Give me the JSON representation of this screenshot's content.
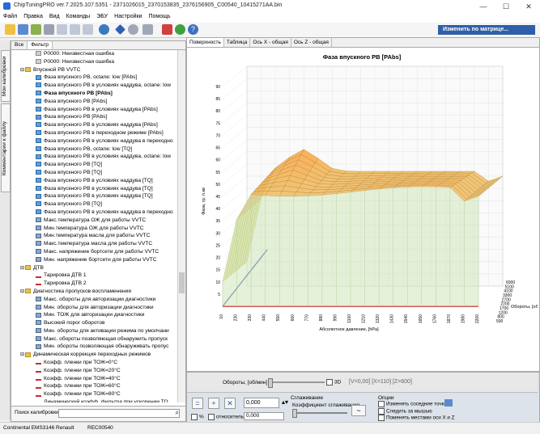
{
  "window": {
    "title": "ChipTuningPRO ver.7.2025.107.5351 - 2371026015_2370153835_2376156905_C00540_10415271AA.bin",
    "minimize": "—",
    "maximize": "☐",
    "close": "✕"
  },
  "menu": [
    "Файл",
    "Правка",
    "Вид",
    "Команды",
    "ЭБУ",
    "Настройки",
    "Помощь"
  ],
  "toolbar": {
    "matrix_dropdown": "Изменить по матрице..."
  },
  "left_tabs": [
    "Мои калибровки",
    "Комментарии к файлу"
  ],
  "panel_tabs": [
    "Все",
    "Фильтр"
  ],
  "tree_rows": [
    {
      "t": "P0000: Неизвестная ошибка",
      "icon": "err",
      "indent": 2
    },
    {
      "t": "P0000: Неизвестная ошибка",
      "icon": "err",
      "indent": 2
    },
    {
      "t": "Впускной РВ VVTC",
      "icon": "folder",
      "indent": 1,
      "toggle": "⊟"
    },
    {
      "t": "Фаза впускного РВ, octane: low [PAbs]",
      "icon": "table",
      "indent": 2
    },
    {
      "t": "Фаза впускного РВ в условиях наддува, octane: low",
      "icon": "table",
      "indent": 2
    },
    {
      "t": "Фаза впускного РВ [PAbs]",
      "icon": "table",
      "indent": 2,
      "selected": true
    },
    {
      "t": "Фаза впускного РВ [PAbs]",
      "icon": "table",
      "indent": 2
    },
    {
      "t": "Фаза впускного РВ в условиях наддува [PAbs]",
      "icon": "table",
      "indent": 2
    },
    {
      "t": "Фаза впускного РВ [PAbs]",
      "icon": "table",
      "indent": 2
    },
    {
      "t": "Фаза впускного РВ в условиях наддува [PAbs]",
      "icon": "table",
      "indent": 2
    },
    {
      "t": "Фаза впускного РВ в переходном режиме [PAbs]",
      "icon": "table",
      "indent": 2
    },
    {
      "t": "Фаза впускного РВ в условиях наддува в переходно",
      "icon": "table",
      "indent": 2
    },
    {
      "t": "Фаза впускного РВ, octane: low [TQ]",
      "icon": "table",
      "indent": 2
    },
    {
      "t": "Фаза впускного РВ в условиях наддува, octane: low",
      "icon": "table",
      "indent": 2
    },
    {
      "t": "Фаза впускного РВ [TQ]",
      "icon": "table",
      "indent": 2
    },
    {
      "t": "Фаза впускного РВ [TQ]",
      "icon": "table",
      "indent": 2
    },
    {
      "t": "Фаза впускного РВ в условиях наддува [TQ]",
      "icon": "table",
      "indent": 2
    },
    {
      "t": "Фаза впускного РВ в условиях наддува [TQ]",
      "icon": "table",
      "indent": 2
    },
    {
      "t": "Фаза впускного РВ в условиях наддува [TQ]",
      "icon": "table",
      "indent": 2
    },
    {
      "t": "Фаза впускного РВ [TQ]",
      "icon": "table",
      "indent": 2
    },
    {
      "t": "Фаза впускного РВ в условиях наддува в переходно",
      "icon": "table",
      "indent": 2
    },
    {
      "t": "Макс.температура ОЖ для работы VVTC",
      "icon": "scalar",
      "indent": 2
    },
    {
      "t": "Мин.температура ОЖ для работы VVTC",
      "icon": "scalar",
      "indent": 2
    },
    {
      "t": "Мин.температура масла для работы VVTC",
      "icon": "scalar",
      "indent": 2
    },
    {
      "t": "Макс.температура масла для работы VVTC",
      "icon": "scalar",
      "indent": 2
    },
    {
      "t": "Макс. напряжение бортсети для работы VVTC",
      "icon": "scalar",
      "indent": 2
    },
    {
      "t": "Мин. напряжение бортсети для работы VVTC",
      "icon": "scalar",
      "indent": 2
    },
    {
      "t": "ДТВ",
      "icon": "folder",
      "indent": 1,
      "toggle": "⊟"
    },
    {
      "t": "Тарировка ДТВ 1",
      "icon": "line",
      "indent": 2
    },
    {
      "t": "Тарировка ДТВ 2",
      "icon": "line",
      "indent": 2
    },
    {
      "t": "Диагностика пропусков воспламенения",
      "icon": "folder",
      "indent": 1,
      "toggle": "⊟"
    },
    {
      "t": "Макс. обороты для авторизации диагностики",
      "icon": "scalar",
      "indent": 2
    },
    {
      "t": "Мин. обороты для авторизации диагностики",
      "icon": "scalar",
      "indent": 2
    },
    {
      "t": "Мин. ТОЖ для авторизации диагностики",
      "icon": "scalar",
      "indent": 2
    },
    {
      "t": "Высокий порог оборотов",
      "icon": "scalar",
      "indent": 2
    },
    {
      "t": "Мин. обороты для активации режима по умолчани",
      "icon": "scalar",
      "indent": 2
    },
    {
      "t": "Макс. обороты позволяющая обнаружить пропуск",
      "icon": "scalar",
      "indent": 2
    },
    {
      "t": "Мин. обороты позволяющая обнаруживать пропус",
      "icon": "scalar",
      "indent": 2
    },
    {
      "t": "Динамическая коррекция переходных режимов",
      "icon": "folder",
      "indent": 1,
      "toggle": "⊟"
    },
    {
      "t": "Коэфф. пленки при ТОЖ=0°C",
      "icon": "line",
      "indent": 2
    },
    {
      "t": "Коэфф. пленки при ТОЖ=20°C",
      "icon": "line",
      "indent": 2
    },
    {
      "t": "Коэфф. пленки при ТОЖ=40°C",
      "icon": "line",
      "indent": 2
    },
    {
      "t": "Коэфф. пленки при ТОЖ=60°C",
      "icon": "line",
      "indent": 2
    },
    {
      "t": "Коэфф. пленки при ТОЖ=80°C",
      "icon": "line",
      "indent": 2
    },
    {
      "t": "Динамический коэфф. фильтра при ускорении ТО",
      "icon": "line",
      "indent": 2
    },
    {
      "t": "Динамический коэфф. фильтра при ускорении ТО",
      "icon": "line",
      "indent": 2
    },
    {
      "t": "Динамический коэфф. фильтра при ускорении ТО",
      "icon": "line",
      "indent": 2
    },
    {
      "t": "Динамический коэфф. фильтра при ускорении ТО",
      "icon": "line",
      "indent": 2
    },
    {
      "t": "Динамический коэфф. фильтра при ускорении ТО",
      "icon": "line",
      "indent": 2
    }
  ],
  "search": {
    "label": "Поиск калибровки"
  },
  "chart_tabs": [
    "Поверхность",
    "Таблица",
    "Ось X - общая",
    "Ось Z - общая"
  ],
  "chart_data": {
    "type": "surface3d",
    "title": "Фаза впускного РВ [PAbs]",
    "zlabel": "Фаза, гр. п.кв",
    "xlabel": "Абсолютное давление, [hPa]",
    "ylabel": "Обороты, [об/мин]",
    "zticks": [
      5,
      10,
      15,
      20,
      25,
      30,
      35,
      40,
      45,
      50,
      55,
      60,
      65,
      70,
      75,
      80,
      85,
      90
    ],
    "xticks": [
      "10",
      "230",
      "330",
      "440",
      "550",
      "660",
      "770",
      "880",
      "990",
      "1100",
      "1210",
      "1320",
      "1430",
      "1540",
      "1650",
      "1760",
      "1870",
      "1980",
      "2200"
    ],
    "yticks": [
      "500",
      "800",
      "1200",
      "1700",
      "2200",
      "2700",
      "3300",
      "4100",
      "5100",
      "6000"
    ],
    "zlim": [
      0,
      90
    ],
    "peak_value": 56,
    "plateau_value": 47,
    "low_value": 10
  },
  "bottom": {
    "rpm_label": "Обороты, [об/мин]",
    "check_3d": "3D",
    "coords": "[V=0,00] [X=110] [Z=600]",
    "value1": "0,000",
    "value2": "0,000",
    "percent": "%",
    "relative": "относительно",
    "smoothing_title": "Сглаживание",
    "smoothing_coef": "Коэффициент сглаживания",
    "options_title": "Опции",
    "opt1": "Изменять соседние точки",
    "opt2": "Следить за мышью",
    "opt3": "Поменять местами оси X и Z"
  },
  "status": {
    "ecu": "Continental EMS3146 Renault",
    "code": "REC00540"
  },
  "colors": {
    "matrix_dd": "#2f5fa8",
    "surface_high": "#e8a040",
    "surface_low": "#bcd9a8"
  }
}
